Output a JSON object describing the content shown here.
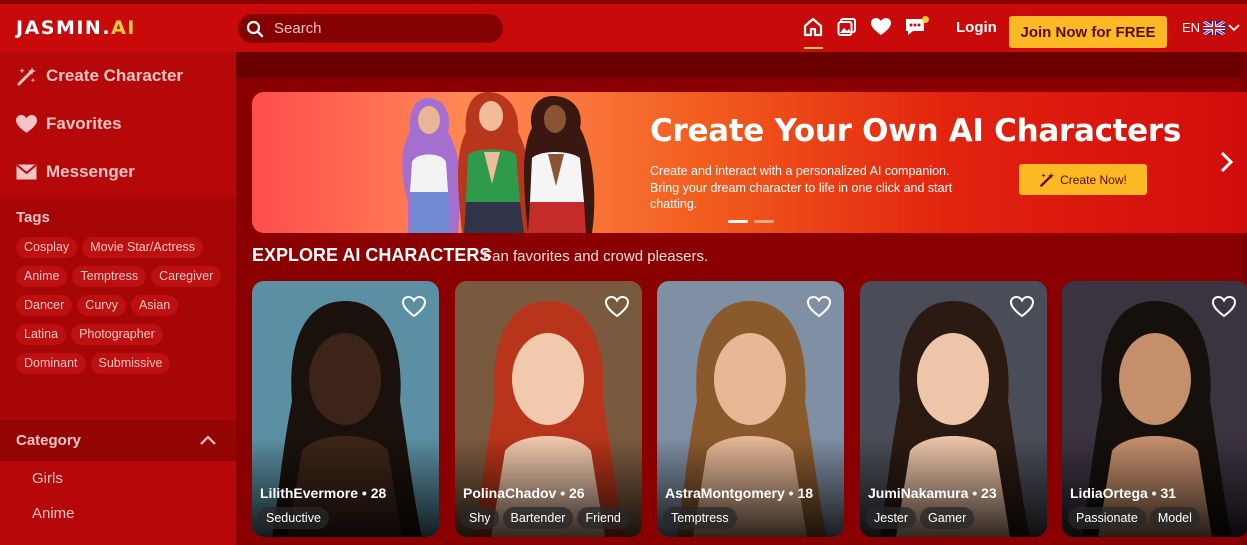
{
  "header": {
    "logo_main": "JASMIN.",
    "logo_ai": "AI",
    "search_placeholder": "Search",
    "login_label": "Login",
    "join_label": "Join Now for FREE",
    "lang_code": "EN"
  },
  "sidebar": {
    "items": [
      {
        "label": "Create Character",
        "icon": "magic-wand-icon"
      },
      {
        "label": "Favorites",
        "icon": "heart-icon"
      },
      {
        "label": "Messenger",
        "icon": "envelope-icon"
      }
    ],
    "tags_title": "Tags",
    "tags": [
      "Cosplay",
      "Movie Star/Actress",
      "Anime",
      "Temptress",
      "Caregiver",
      "Dancer",
      "Curvy",
      "Asian",
      "Latina",
      "Photographer",
      "Dominant",
      "Submissive"
    ],
    "category_title": "Category",
    "categories": [
      "Girls",
      "Anime"
    ]
  },
  "banner": {
    "title": "Create Your Own AI Characters",
    "text": "Create and interact with a personalized AI companion. Bring your dream character to life in one click and start chatting.",
    "cta_label": "Create Now!",
    "slide_count": 2,
    "active_slide": 1
  },
  "section": {
    "title": "EXPLORE AI CHARACTERS",
    "subtitle": "Fan favorites and crowd pleasers."
  },
  "cards": [
    {
      "name": "LilithEvermore • 28",
      "tags": [
        "Seductive"
      ],
      "bg": "#5b8fa3"
    },
    {
      "name": "PolinaChadov • 26",
      "tags": [
        "Shy",
        "Bartender",
        "Friend"
      ],
      "bg": "#7a5a3e"
    },
    {
      "name": "AstraMontgomery • 18",
      "tags": [
        "Temptress"
      ],
      "bg": "#7f8fa4"
    },
    {
      "name": "JumiNakamura • 23",
      "tags": [
        "Jester",
        "Gamer"
      ],
      "bg": "#4a4d57"
    },
    {
      "name": "LidiaOrtega • 31",
      "tags": [
        "Passionate",
        "Model"
      ],
      "bg": "#3c3340"
    }
  ],
  "colors": {
    "topbar": "#c80a0a",
    "sidebar": "#b60808",
    "accent": "#fbb923",
    "background": "#8a0000"
  }
}
